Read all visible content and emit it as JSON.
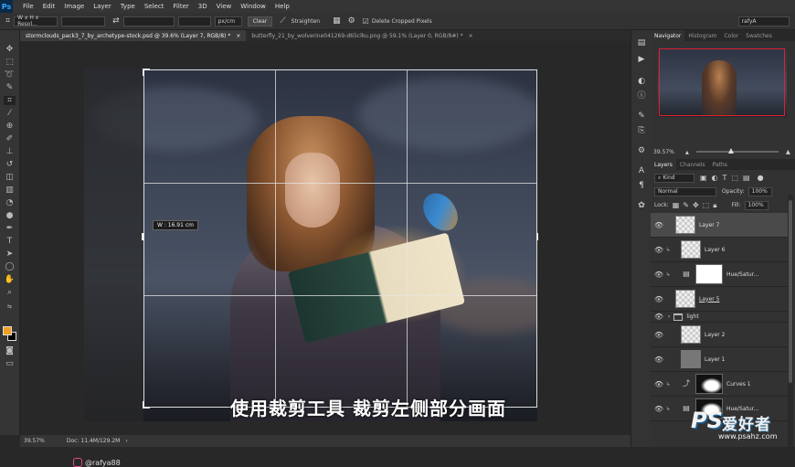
{
  "app": {
    "logo": "Ps"
  },
  "menu": [
    "File",
    "Edit",
    "Image",
    "Layer",
    "Type",
    "Select",
    "Filter",
    "3D",
    "View",
    "Window",
    "Help"
  ],
  "options_bar": {
    "ratio_select": "W x H x Resol...",
    "unit_select": "px/cm",
    "clear_label": "Clear",
    "straighten_label": "Straighten",
    "delete_cropped_label": "Delete Cropped Pixels",
    "workspace_select": "rafyA"
  },
  "doc_tabs": [
    {
      "label": "stormclouds_pack3_7_by_archetype-stock.psd @ 39.6% (Layer 7, RGB/8) *",
      "close": "×",
      "active": true
    },
    {
      "label": "butterfly_21_by_wolverine041269-d65clku.png @ 59.1% (Layer 0, RGB/8#) *",
      "close": "×",
      "active": false
    }
  ],
  "canvas": {
    "crop_tooltip": "W :  16.91 cm",
    "caption": "使用裁剪工具 裁剪左侧部分画面",
    "watermark_handle": "@rafya88"
  },
  "status": {
    "zoom": "39.57%",
    "doc": "Doc: 11.4M/129.2M"
  },
  "navigator": {
    "tabs": [
      "Navigator",
      "Histogram",
      "Color",
      "Swatches"
    ],
    "zoom": "39.57%"
  },
  "layers_panel": {
    "tabs": [
      "Layers",
      "Channels",
      "Paths"
    ],
    "kind": "Kind",
    "blend_mode": "Normal",
    "opacity_label": "Opacity:",
    "opacity_value": "100%",
    "lock_label": "Lock:",
    "fill_label": "Fill:",
    "fill_value": "100%",
    "layers": [
      {
        "name": "Layer 7",
        "thumb": "transparent",
        "selected": true,
        "clip": false
      },
      {
        "name": "Layer 6",
        "thumb": "transparent",
        "selected": false,
        "clip": true
      },
      {
        "name": "Hue/Satur...",
        "thumb": "adjustment",
        "selected": false,
        "clip": true
      },
      {
        "name": "Layer 5",
        "thumb": "transparent",
        "selected": false,
        "clip": false
      },
      {
        "name": "light",
        "thumb": "folder",
        "selected": false,
        "clip": false
      },
      {
        "name": "Layer 2",
        "thumb": "transparent",
        "selected": false,
        "clip": false
      },
      {
        "name": "Layer 1",
        "thumb": "dark",
        "selected": false,
        "clip": false
      },
      {
        "name": "Curves 1",
        "thumb": "curves",
        "selected": false,
        "clip": true
      },
      {
        "name": "Hue/Satur...",
        "thumb": "adjustment",
        "selected": false,
        "clip": true
      }
    ]
  },
  "brand_watermark": {
    "mark": "PS",
    "name": "爱好者",
    "url": "www.psahz.com"
  },
  "colors": {
    "foreground": "#f0a020",
    "background": "#000000",
    "nav_view_border": "#e0202c"
  }
}
